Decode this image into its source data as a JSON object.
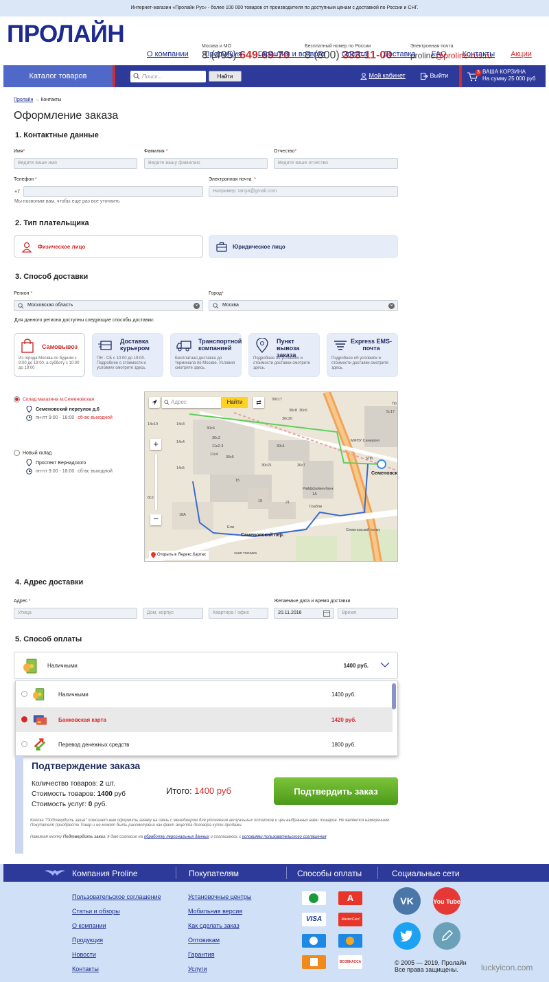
{
  "topbar": {
    "text": "Интернет-магазин «Пролайн Рус» - более 100 000 товаров от производителя по доступным ценам с доставкой по России и СНГ."
  },
  "header": {
    "logo": "ПРОЛАЙН",
    "phones": [
      {
        "caption": "Москва и МО",
        "prefix": "8 (495) ",
        "number": "649-69-70"
      },
      {
        "caption": "Бесплатный номер по России",
        "prefix": "8 (800) ",
        "number": "333-11-00"
      },
      {
        "caption": "Электронная почта",
        "prefix": "proline",
        "number": "@proline-rus.ru"
      }
    ],
    "nav": [
      "О компании",
      "Продукция",
      "Гарантия и возврат",
      "Оплата",
      "Доставка",
      "FAQ",
      "Контакты",
      "Акции"
    ]
  },
  "bar": {
    "catalog": "Каталог товаров",
    "search_placeholder": "Поиск...",
    "find": "Найти",
    "cabinet": "Мой кабинет",
    "exit": "Выйти",
    "cart_count": "3",
    "cart_title": "ВАША КОРЗИНА",
    "cart_sum": "На сумму 25 000 руб"
  },
  "breadcrumb": {
    "home": "Пролайн",
    "sep": " → ",
    "current": "Контакты"
  },
  "page_title": "Оформление заказа",
  "contacts": {
    "title": "1. Контактные данные",
    "name_label": "Имя",
    "name_ph": "Ведите ваше имя",
    "surname_label": "Фамилия",
    "surname_ph": "Ведите вашу фамилию",
    "patronymic_label": "Отчество",
    "patronymic_ph": "Ведите ваше отчество",
    "phone_label": "Телефон",
    "phone_prefix": "+7",
    "phone_note": "Мы позвоним вам, чтобы еще раз все уточнить",
    "email_label": "Электронная почта",
    "email_ph": "Например: tanya@gmail.com",
    "star": "*"
  },
  "payer": {
    "title": "2. Тип плательщика",
    "individual": "Физическое лицо",
    "legal": "Юридическое лицо"
  },
  "delivery": {
    "title": "3. Способ доставки",
    "region_label": "Регион",
    "region_value": "Московская область",
    "city_label": "Город",
    "city_value": "Москва",
    "available": "Для данного региона доступны следующие способы доставки:",
    "options": [
      {
        "title": "Самовывоз",
        "desc": "Из города Москва по будним с 9:00 до 19:00, а субботу с 10:00 до 19:00"
      },
      {
        "title": "Доставка курьером",
        "desc": "ПН - СБ с 10:00 до 19:00. Подробнее о стоимости и условиях смотрите здесь."
      },
      {
        "title": "Транспортной компанией",
        "desc": "Бесплатная доставка до терминала по Москве. Условия смотрите здесь."
      },
      {
        "title": "Пункт вывоза заказа",
        "desc": "Подробнее об условиях и стоимости доставки смотрите здесь."
      },
      {
        "title": "Express EMS-почта",
        "desc": "Подробнее об условиях и стоимости доставки смотрите здесь."
      }
    ],
    "stores": [
      {
        "name": "Склад магазина м.Семеновская",
        "address": "Семеновский переулок д.6",
        "hours": "пн-пт 9:00 - 18:00",
        "weekend": "сб-вс выходной"
      },
      {
        "name": "Новый склад",
        "address": "Проспект Вернадского",
        "hours": "пн-пт 9:00 - 18:00",
        "weekend": "сб-вс выходной"
      }
    ],
    "map": {
      "address_ph": "Адрес",
      "find": "Найти",
      "open_link": "Открыть в Яндекс.Картах",
      "labels": [
        "Семеновская",
        "Семеновский пер.",
        "МФПУ Синергия",
        "Райффайзенбанк",
        "Грабли",
        "Ели",
        "Семеновский полку",
        "зная техника",
        "30с17",
        "30с8",
        "30с6",
        "30с20",
        "30с4",
        "30с3",
        "30с1",
        "11с2-3",
        "11с4",
        "30с5",
        "30с21",
        "30с7",
        "14с3",
        "14с4",
        "14с5",
        "14с10",
        "15",
        "18А",
        "1А",
        "19",
        "21",
        "8с2",
        "5ПБ",
        "5с17",
        "Пр"
      ]
    }
  },
  "address": {
    "title": "4. Адрес доставки",
    "label": "Адрес",
    "street_ph": "Улица",
    "house_ph": "Дом, корпус",
    "flat_ph": "Квартира / офис",
    "date_label": "Желаемые дата и время доставки",
    "date_value": "20.11.2016",
    "time_ph": "Время"
  },
  "payment": {
    "title": "5. Способ оплаты",
    "selected": {
      "label": "Наличными",
      "price": "1400 руб."
    },
    "options": [
      {
        "label": "Наличными",
        "price": "1400 руб."
      },
      {
        "label": "Банковская карта",
        "price": "1420 руб."
      },
      {
        "label": "Перевод денежных средств",
        "price": "1800 руб."
      }
    ]
  },
  "confirm": {
    "title": "Подтверждение заказа",
    "count_label": "Количество товаров: ",
    "count": "2",
    "count_unit": " шт.",
    "cost_label": "Стоимость товаров: ",
    "cost": "1400",
    "cost_unit": " руб",
    "services_label": "Стоимость услуг: ",
    "services": "0",
    "services_unit": " руб.",
    "total_label": "Итого: ",
    "total": "1400 руб",
    "button": "Подтвердить заказ",
    "fine1": "Кнопка \"Подтвердить заказ\" помогает вам оформить заявку на связь с менеджером для уточнения актуальных остатков и цен выбранных вами товаров. Не является намерением Покупателя приобрести Товар и не может быть рассмотрена как факт акцепта договора купли-продажи.",
    "fine2_a": "Нажимая кнопку ",
    "fine2_b": "Подтвердить заказ",
    "fine2_c": ", я даю согласие на ",
    "fine2_link1": "обработку персональных данных",
    "fine2_d": " и соглашаюсь с ",
    "fine2_link2": "условиями пользовательского соглашения"
  },
  "footer": {
    "heads": [
      "Компания Proline",
      "Покупателям",
      "Способы оплаты",
      "Социальные сети"
    ],
    "col1": [
      "Пользовательское соглашение",
      "Статьи и обзоры",
      "О компании",
      "Продукция",
      "Новости",
      "Контакты"
    ],
    "col2": [
      "Установочные центры",
      "Мобильная версия",
      "Как сделать заказ",
      "Оптовикам",
      "Гарантия",
      "Услуги"
    ],
    "pay_labels": [
      "VISA",
      "MasterCard",
      "ВОЗВКАССА"
    ],
    "social": [
      "VK",
      "You Tube"
    ],
    "copyright1": "© 2005 — 2019, Пролайн",
    "copyright2": "Все права защищены.",
    "watermark": "luckyicon.com"
  },
  "colors": {
    "brand": "#1d2a8f",
    "accent": "#d12b2b",
    "bar": "#2d3a9a",
    "green": "#5aac23"
  }
}
